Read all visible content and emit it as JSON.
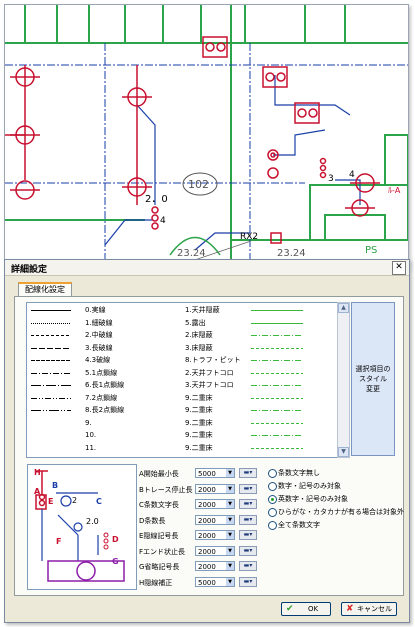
{
  "dialog": {
    "title": "詳細設定",
    "close_glyph": "✕",
    "tab_label": "配線化設定",
    "style_button_label": "選択項目の\nスタイル\n変更",
    "ok_label": "OK",
    "cancel_label": "キャンセル"
  },
  "line_list": [
    {
      "name": "0.実線",
      "room": "1.天井隠蔽"
    },
    {
      "name": "1.細破線",
      "room": "5.露出"
    },
    {
      "name": "2.中破線",
      "room": "2.床隠蔽"
    },
    {
      "name": "3.長破線",
      "room": "3.床隠蔽"
    },
    {
      "name": "4.3破線",
      "room": "8.トラフ・ピット"
    },
    {
      "name": "5.1点鎖線",
      "room": "2.天井フトコロ"
    },
    {
      "name": "6.長1点鎖線",
      "room": "3.天井フトコロ"
    },
    {
      "name": "7.2点鎖線",
      "room": "9.二重床"
    },
    {
      "name": "8.長2点鎖線",
      "room": "9.二重床"
    },
    {
      "name": "9.",
      "room": "9.二重床"
    },
    {
      "name": "10.",
      "room": "9.二重床"
    },
    {
      "name": "11.",
      "room": "9.二重床"
    }
  ],
  "params": [
    {
      "label": "A開始最小長",
      "value": "5000"
    },
    {
      "label": "Bトレース停止長",
      "value": "2000"
    },
    {
      "label": "C条数文字長",
      "value": "2000"
    },
    {
      "label": "D条数長",
      "value": "2000"
    },
    {
      "label": "E隠線記号長",
      "value": "2000"
    },
    {
      "label": "Fエンド状止長",
      "value": "2000"
    },
    {
      "label": "G省略記号長",
      "value": "2000"
    },
    {
      "label": "H隠線補正",
      "value": "5000"
    }
  ],
  "radio_options": [
    {
      "label": "条数文字無し",
      "selected": false
    },
    {
      "label": "数字・記号のみ対象",
      "selected": false
    },
    {
      "label": "英数字・記号のみ対象",
      "selected": true
    },
    {
      "label": "ひらがな・カタカナが有る場合は対象外",
      "selected": false
    },
    {
      "label": "全て条数文字",
      "selected": false
    }
  ],
  "cad": {
    "room_number": "102",
    "dim_text_1": "2．0",
    "dim_text_2": "4",
    "dim_text_3": "23.24",
    "dim_text_4": "23.24",
    "tag_text": "RX2",
    "count_3": "3",
    "count_4": "4",
    "ps_label": "PS",
    "side_text": "ﾙ-A"
  },
  "preview": {
    "labels": [
      "A",
      "B",
      "C",
      "D",
      "E",
      "F",
      "G",
      "H"
    ],
    "num_text": "2",
    "num_text_b": "2.0"
  },
  "colors": {
    "accent_green": "#3ab83a",
    "cad_red": "#c8102e",
    "cad_blue": "#1a3fa8",
    "cad_wall": "#2ca44a"
  }
}
